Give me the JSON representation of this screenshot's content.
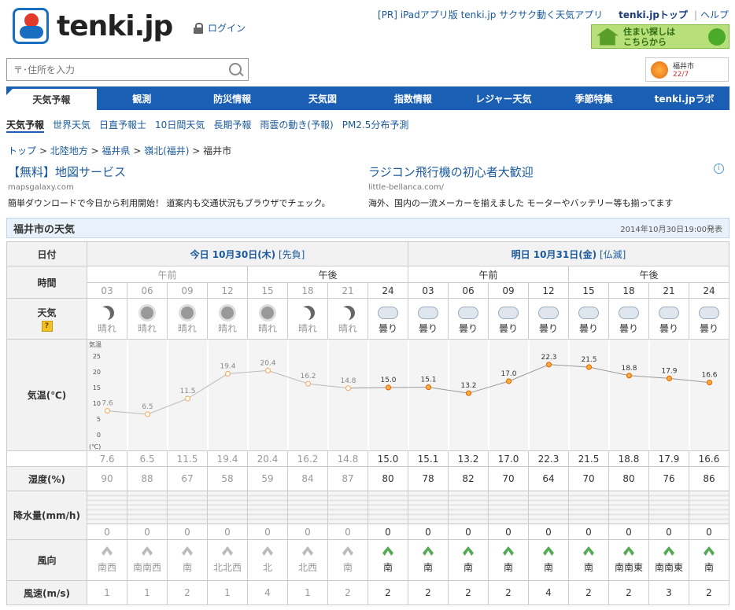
{
  "brand": {
    "logo": "tenki.jp",
    "login": "ログイン"
  },
  "top": {
    "pr": "[PR] iPadアプリ版 tenki.jp サクサク動く天気アプリ",
    "top_link": "tenki.jpトップ",
    "help": "ヘルプ",
    "banner": "住まい探しは\nこちらから"
  },
  "search": {
    "placeholder": "〒･住所を入力"
  },
  "city_widget": {
    "city": "福井市",
    "temp": "22/7"
  },
  "nav": [
    "天気予報",
    "観測",
    "防災情報",
    "天気図",
    "指数情報",
    "レジャー天気",
    "季節特集",
    "tenki.jpラボ"
  ],
  "subnav": [
    "天気予報",
    "世界天気",
    "日直予報士",
    "10日間天気",
    "長期予報",
    "雨雲の動き(予報)",
    "PM2.5分布予測"
  ],
  "breadcrumb": [
    "トップ",
    "北陸地方",
    "福井県",
    "嶺北(福井)",
    "福井市"
  ],
  "ads": [
    {
      "title": "【無料】地図サービス",
      "url": "mapsgalaxy.com",
      "desc": "簡単ダウンロードで今日から利用開始！ 道案内も交通状況もブラウザでチェック。"
    },
    {
      "title": "ラジコン飛行機の初心者大歓迎",
      "url": "little-bellanca.com/",
      "desc": "海外、国内の一流メーカーを揃えました モーターやバッテリー等も揃ってます"
    }
  ],
  "ad_info": "i",
  "panel": {
    "title": "福井市の天気",
    "published": "2014年10月30日19:00発表"
  },
  "labels": {
    "date": "日付",
    "time": "時間",
    "weather": "天気",
    "temp": "気温(℃)",
    "humidity": "湿度(%)",
    "rain": "降水量(mm/h)",
    "wdir": "風向",
    "wspeed": "風速(m/s)",
    "help": "?"
  },
  "days": [
    {
      "label": "今日 10月30日(木)",
      "rokuyo": "[先負]",
      "am": "午前",
      "pm": "午後"
    },
    {
      "label": "明日 10月31日(金)",
      "rokuyo": "[仏滅]",
      "am": "午前",
      "pm": "午後"
    }
  ],
  "hours": [
    "03",
    "06",
    "09",
    "12",
    "15",
    "18",
    "21",
    "24",
    "03",
    "06",
    "09",
    "12",
    "15",
    "18",
    "21",
    "24"
  ],
  "weather": [
    "晴れ",
    "晴れ",
    "晴れ",
    "晴れ",
    "晴れ",
    "晴れ",
    "晴れ",
    "曇り",
    "曇り",
    "曇り",
    "曇り",
    "曇り",
    "曇り",
    "曇り",
    "曇り",
    "曇り"
  ],
  "weather_icons": [
    "moon-icon",
    "sun-icon",
    "sun-icon",
    "sun-icon",
    "sun-icon",
    "moon-icon",
    "moon-icon",
    "cloud-icon",
    "cloud-icon",
    "cloud-icon",
    "cloud-icon",
    "cloud-icon",
    "cloud-icon",
    "cloud-icon",
    "cloud-icon",
    "cloud-icon"
  ],
  "humidity": [
    "90",
    "88",
    "67",
    "58",
    "59",
    "84",
    "87",
    "80",
    "78",
    "82",
    "70",
    "64",
    "70",
    "80",
    "76",
    "86"
  ],
  "rain": [
    "0",
    "0",
    "0",
    "0",
    "0",
    "0",
    "0",
    "0",
    "0",
    "0",
    "0",
    "0",
    "0",
    "0",
    "0",
    "0"
  ],
  "wind_dir": [
    "南西",
    "南南西",
    "南",
    "北北西",
    "北",
    "北西",
    "南",
    "南",
    "南",
    "南",
    "南",
    "南",
    "南",
    "南南東",
    "南南東",
    "南"
  ],
  "wind_speed": [
    "1",
    "1",
    "2",
    "1",
    "4",
    "1",
    "2",
    "2",
    "2",
    "2",
    "2",
    "4",
    "2",
    "2",
    "3",
    "2"
  ],
  "chart_data": {
    "type": "line",
    "x": [
      "03",
      "06",
      "09",
      "12",
      "15",
      "18",
      "21",
      "24",
      "03",
      "06",
      "09",
      "12",
      "15",
      "18",
      "21",
      "24"
    ],
    "values": [
      7.6,
      6.5,
      11.5,
      19.4,
      20.4,
      16.2,
      14.8,
      15.0,
      15.1,
      13.2,
      17.0,
      22.3,
      21.5,
      18.8,
      17.9,
      16.6
    ],
    "ylabel": "気温",
    "yunit": "(℃)",
    "yticks": [
      0,
      5,
      10,
      15,
      20,
      25
    ],
    "ylim": [
      -2,
      27
    ],
    "past_count": 7,
    "colors": {
      "past": "#f2b26b",
      "future": "#e66b00",
      "line_past": "#bbbbbb",
      "line_future": "#999999"
    }
  }
}
